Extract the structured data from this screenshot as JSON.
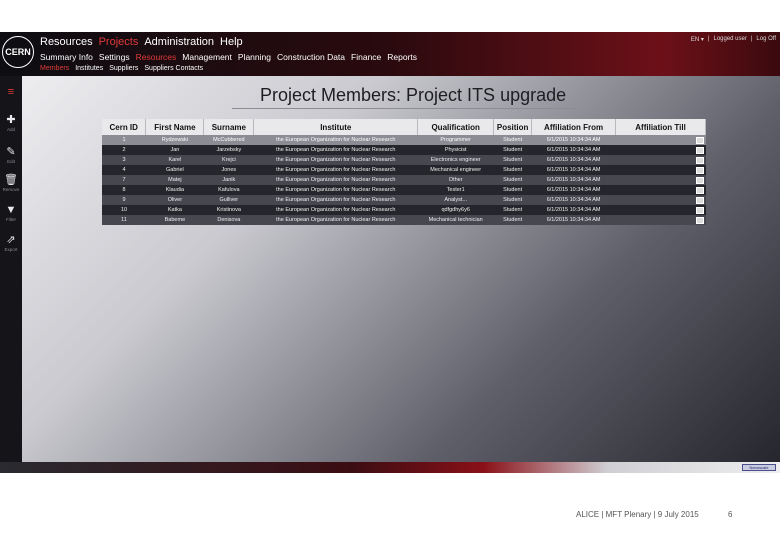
{
  "logo": "CERN",
  "header": {
    "main_menu": [
      "Resources",
      "Projects",
      "Administration",
      "Help"
    ],
    "sub_menu": [
      "Summary Info",
      "Settings",
      "Resources",
      "Management",
      "Planning",
      "Construction Data",
      "Finance",
      "Reports"
    ],
    "third_menu": [
      "Members",
      "Institutes",
      "Suppliers",
      "Suppliers Contacts"
    ],
    "user_links": [
      "EN ▾",
      "|",
      "Logged user",
      "|",
      "Log Off"
    ]
  },
  "sidebar": [
    {
      "icon": "menu-icon",
      "glyph": "≡",
      "label": ""
    },
    {
      "icon": "add-icon",
      "glyph": "✚",
      "label": "Add"
    },
    {
      "icon": "edit-icon",
      "glyph": "✎",
      "label": "Edit"
    },
    {
      "icon": "trash-icon",
      "glyph": "🗑",
      "label": "Remove"
    },
    {
      "icon": "filter-icon",
      "glyph": "▼",
      "label": "Filter"
    },
    {
      "icon": "export-icon",
      "glyph": "⇗",
      "label": "Export"
    }
  ],
  "page_title": "Project Members: Project ITS upgrade",
  "table": {
    "columns": [
      "Cern ID",
      "First Name",
      "Surname",
      "Institute",
      "Qualification",
      "Position",
      "Affiliation From",
      "Affiliation Till"
    ],
    "rows": [
      [
        "1",
        "Rydzewski",
        "McCubbered",
        "the European Organization for Nuclear Research",
        "Programmer",
        "Student",
        "6/1/2015 10:34:34 AM",
        ""
      ],
      [
        "2",
        "Jan",
        "Jarzebsky",
        "the European Organization for Nuclear Research",
        "Physicist",
        "Student",
        "6/1/2015 10:34:34 AM",
        ""
      ],
      [
        "3",
        "Karel",
        "Krejci",
        "the European Organization for Nuclear Research",
        "Electronics engineer",
        "Student",
        "6/1/2015 10:34:34 AM",
        ""
      ],
      [
        "4",
        "Gabriel",
        "Jones",
        "the European Organization for Nuclear Research",
        "Mechanical engineer",
        "Student",
        "6/1/2015 10:34:34 AM",
        ""
      ],
      [
        "7",
        "Matej",
        "Janik",
        "the European Organization for Nuclear Research",
        "Other",
        "Student",
        "6/1/2015 10:34:34 AM",
        ""
      ],
      [
        "8",
        "Klaudia",
        "Kafulova",
        "the European Organization for Nuclear Research",
        "Tester1",
        "Student",
        "6/1/2015 10:34:34 AM",
        ""
      ],
      [
        "9",
        "Oliver",
        "Gulliver",
        "the European Organization for Nuclear Research",
        "Analyst...",
        "Student",
        "6/1/2015 10:34:34 AM",
        ""
      ],
      [
        "10",
        "Katka",
        "Kristinova",
        "the European Organization for Nuclear Research",
        "qdfgdhy6y6",
        "Student",
        "6/1/2015 10:34:34 AM",
        ""
      ],
      [
        "11",
        "Babeme",
        "Denisova",
        "the European Organization for Nuclear Research",
        "Mechanical technician",
        "Student",
        "6/1/2015 10:34:34 AM",
        ""
      ]
    ],
    "selected_row_index": 0
  },
  "footer_badge": "Nanoscale",
  "slide_footer": "ALICE | MFT Plenary | 9 July 2015",
  "slide_number": "6",
  "colors": {
    "accent": "#e23a3a",
    "header_red": "#6d1018"
  }
}
